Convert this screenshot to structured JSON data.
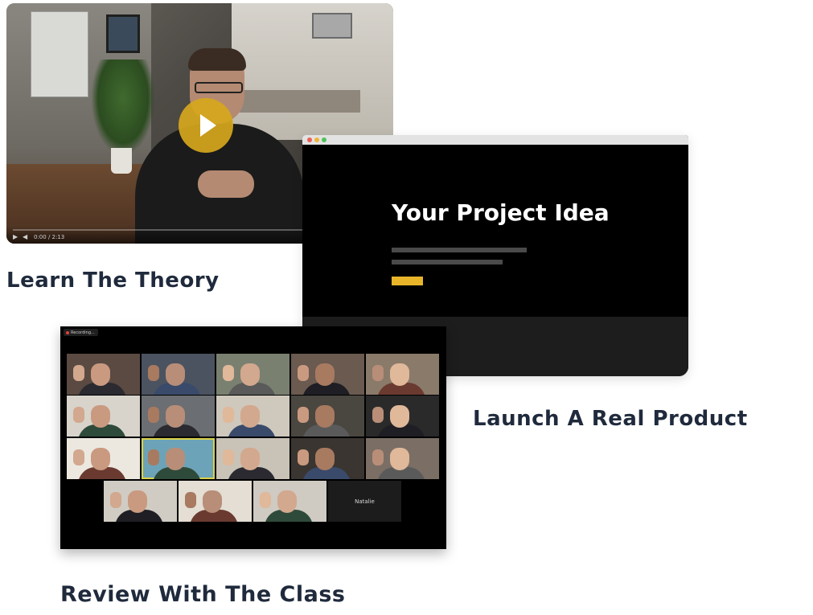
{
  "sections": {
    "theory_caption": "Learn The Theory",
    "launch_caption": "Launch A Real Product",
    "review_caption": "Review With The Class"
  },
  "video": {
    "time_readout": "0:00 / 2:13"
  },
  "browser": {
    "title": "Your Project Idea"
  },
  "meeting": {
    "recording_label": "Recording...",
    "named_participant": "Natalie"
  },
  "colors": {
    "accent_yellow": "#e8b52a",
    "caption_text": "#1f2a3c",
    "play_button": "#d6a71c"
  }
}
